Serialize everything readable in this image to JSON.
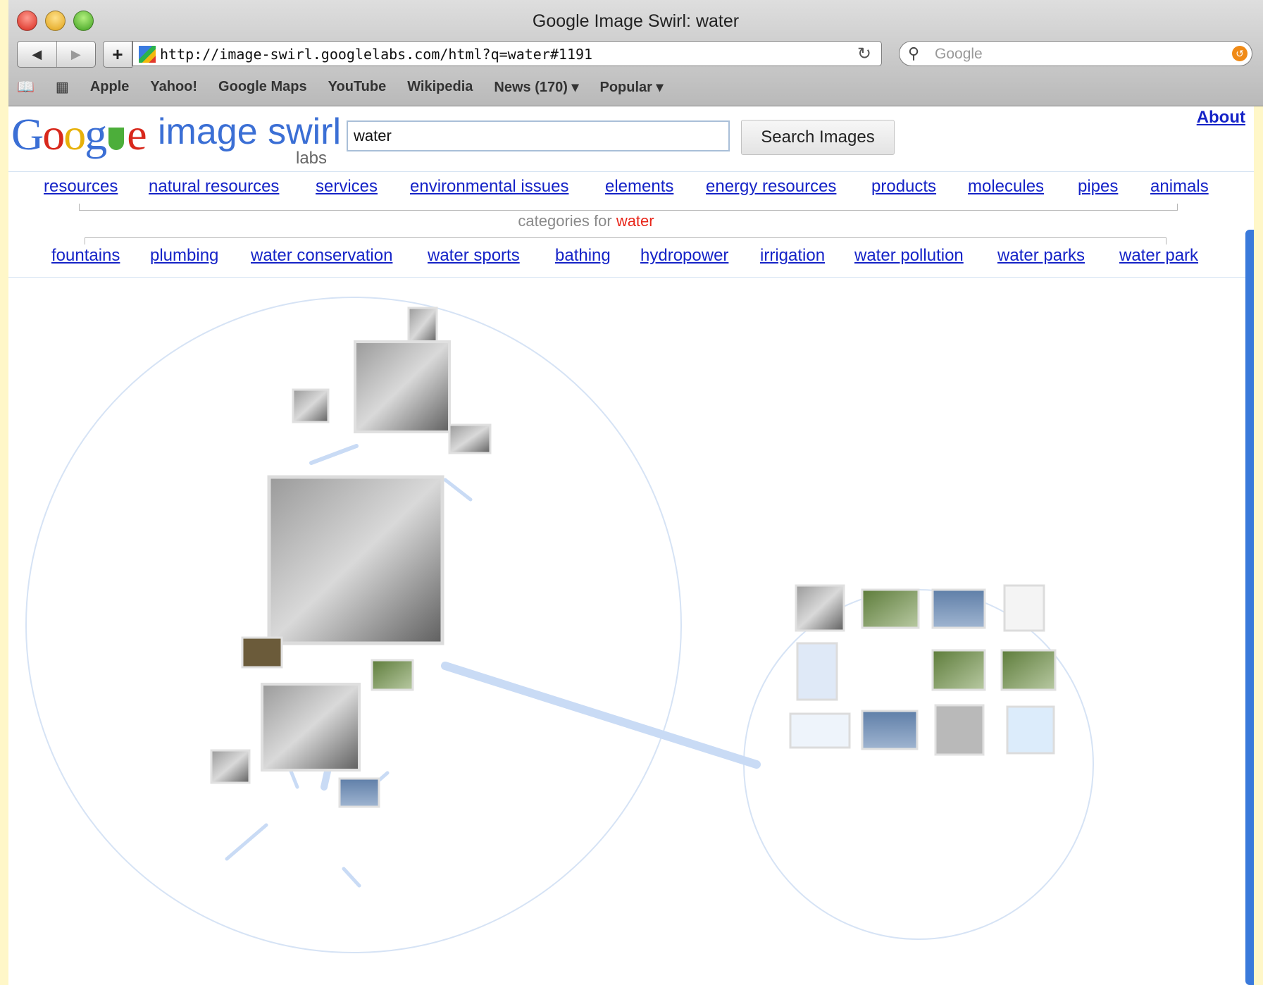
{
  "window": {
    "title": "Google Image Swirl: water"
  },
  "toolbar": {
    "back_icon": "back-arrow-icon",
    "forward_icon": "forward-arrow-icon",
    "add_label": "+",
    "url": "http://image-swirl.googlelabs.com/html?q=water#1191",
    "reload_label": "C",
    "search_placeholder": "Google"
  },
  "bookmarks": [
    "Apple",
    "Yahoo!",
    "Google Maps",
    "YouTube",
    "Wikipedia",
    "News (170) ▾",
    "Popular ▾"
  ],
  "page": {
    "logo_text": "Google",
    "product_name": "image swirl",
    "labs_label": "labs",
    "query_value": "water",
    "search_button": "Search Images",
    "about_link": "About",
    "categories_prefix": "categories for",
    "categories_query": "water",
    "top_categories": [
      "resources",
      "natural resources",
      "services",
      "environmental issues",
      "elements",
      "energy resources",
      "products",
      "molecules",
      "pipes",
      "animals"
    ],
    "bottom_categories": [
      "fountains",
      "plumbing",
      "water conservation",
      "water sports",
      "bathing",
      "hydropower",
      "irrigation",
      "water pollution",
      "water parks",
      "water park"
    ]
  },
  "colors": {
    "link": "#1523c7",
    "query_highlight": "#e8261a",
    "swirl_edge": "#c9dbf5",
    "scrollbar": "#3a7adb"
  }
}
